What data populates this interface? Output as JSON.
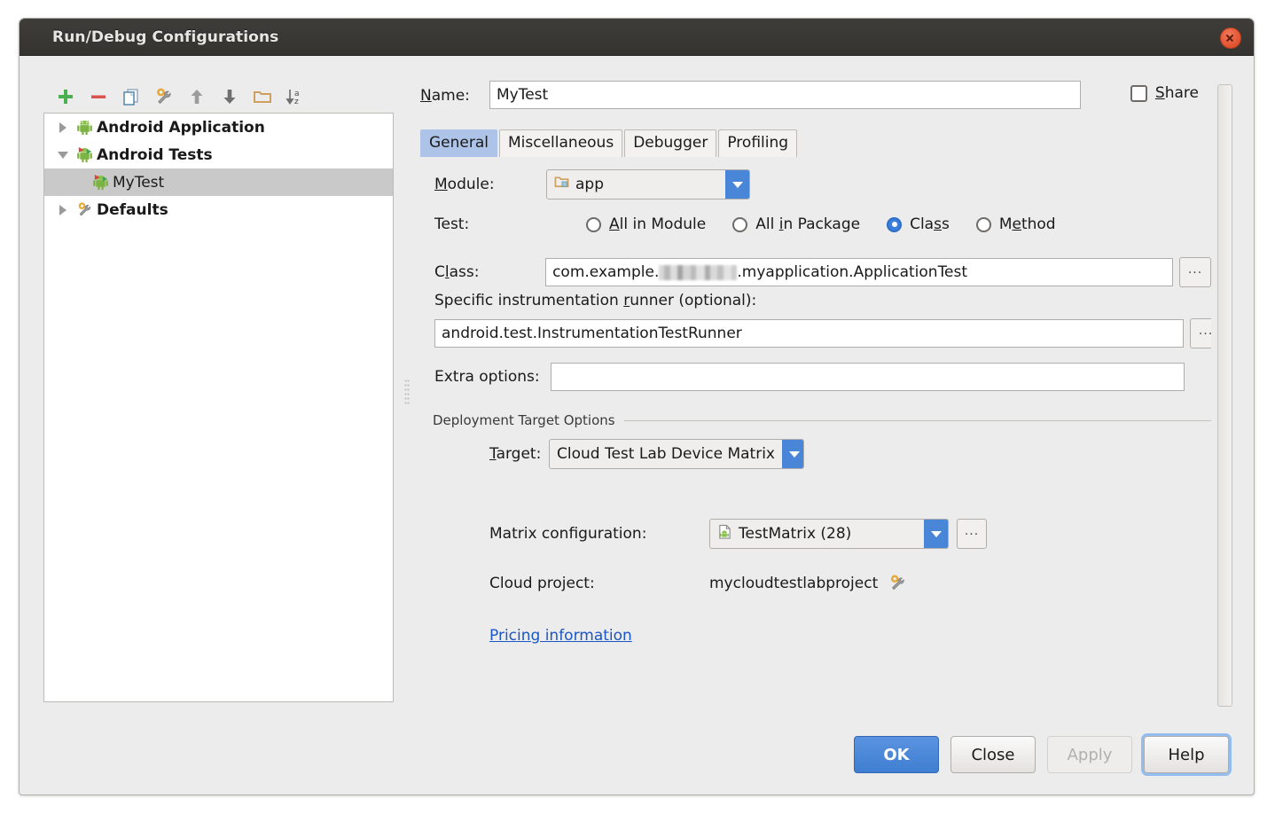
{
  "window": {
    "title": "Run/Debug Configurations",
    "close_icon": "close-icon"
  },
  "tree_toolbar": {
    "items": [
      {
        "name": "add-configuration-button",
        "icon": "plus-icon",
        "tooltip": "Add New Configuration"
      },
      {
        "name": "remove-configuration-button",
        "icon": "minus-icon",
        "tooltip": "Remove Configuration"
      },
      {
        "name": "copy-configuration-button",
        "icon": "copy-icon",
        "tooltip": "Copy Configuration"
      },
      {
        "name": "edit-defaults-button",
        "icon": "wrench-gear-icon",
        "tooltip": "Edit Defaults"
      },
      {
        "name": "move-up-button",
        "icon": "arrow-up-icon",
        "tooltip": "Move Up"
      },
      {
        "name": "move-down-button",
        "icon": "arrow-down-icon",
        "tooltip": "Move Down"
      },
      {
        "name": "create-folder-button",
        "icon": "folder-icon",
        "tooltip": "Create New Folder"
      },
      {
        "name": "sort-alphabetically-button",
        "icon": "sort-az-icon",
        "tooltip": "Sort Configurations"
      }
    ]
  },
  "tree": {
    "nodes": [
      {
        "label": "Android Application",
        "icon": "android-icon",
        "expanded": false,
        "bold": true,
        "selected": false,
        "child": false
      },
      {
        "label": "Android Tests",
        "icon": "android-test-icon",
        "expanded": true,
        "bold": true,
        "selected": false,
        "child": false
      },
      {
        "label": "MyTest",
        "icon": "android-test-icon",
        "expanded": null,
        "bold": false,
        "selected": true,
        "child": true
      },
      {
        "label": "Defaults",
        "icon": "wrench-gear-icon",
        "expanded": false,
        "bold": true,
        "selected": false,
        "child": false
      }
    ]
  },
  "form": {
    "name_label": "Name:",
    "name_value": "MyTest",
    "share_label": "Share",
    "share_checked": false,
    "tabs": [
      {
        "label": "General",
        "active": true
      },
      {
        "label": "Miscellaneous",
        "active": false
      },
      {
        "label": "Debugger",
        "active": false
      },
      {
        "label": "Profiling",
        "active": false
      }
    ],
    "module_label": "Module:",
    "module_value": "app",
    "module_icon": "module-folder-icon",
    "test_label": "Test:",
    "test_options": [
      {
        "label": "All in Module",
        "checked": false
      },
      {
        "label": "All in Package",
        "checked": false
      },
      {
        "label": "Class",
        "checked": true
      },
      {
        "label": "Method",
        "checked": false
      }
    ],
    "class_label": "Class:",
    "class_value_prefix": "com.example.",
    "class_value_suffix": ".myapplication.ApplicationTest",
    "class_value_redacted": true,
    "class_browse_label": "...",
    "runner_label": "Specific instrumentation runner (optional):",
    "runner_value": "android.test.InstrumentationTestRunner",
    "runner_browse_label": "...",
    "extra_options_label": "Extra options:",
    "extra_options_value": "",
    "deployment_group_title": "Deployment Target Options",
    "target_label": "Target:",
    "target_value": "Cloud Test Lab Device Matrix",
    "matrix_label": "Matrix configuration:",
    "matrix_value": "TestMatrix (28)",
    "matrix_icon": "matrix-file-icon",
    "matrix_browse_label": "...",
    "cloud_project_label": "Cloud project:",
    "cloud_project_value": "mycloudtestlabproject",
    "cloud_project_icon": "wrench-gear-icon",
    "pricing_link": "Pricing information"
  },
  "buttons": [
    {
      "label": "OK",
      "style": "primary"
    },
    {
      "label": "Close",
      "style": "normal"
    },
    {
      "label": "Apply",
      "style": "disabled"
    },
    {
      "label": "Help",
      "style": "focused"
    }
  ],
  "colors": {
    "accent_blue": "#3f7ed1",
    "combo_arrow_blue": "#4a86d8",
    "tab_active": "#aec3e8",
    "link": "#1a57c4",
    "titlebar": "#35332f",
    "close_red": "#e0522f",
    "dialog_bg": "#ececec"
  }
}
